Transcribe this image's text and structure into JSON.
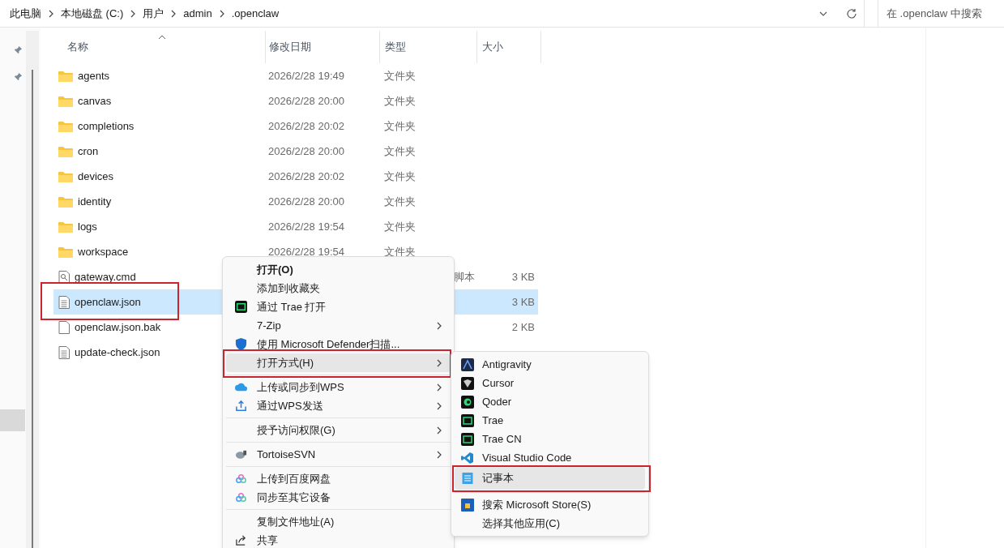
{
  "breadcrumb": [
    "此电脑",
    "本地磁盘 (C:)",
    "用户",
    "admin",
    ".openclaw"
  ],
  "search": {
    "placeholder": "在 .openclaw 中搜索"
  },
  "columns": [
    "名称",
    "修改日期",
    "类型",
    "大小"
  ],
  "rows": [
    {
      "kind": "folder",
      "name": "agents",
      "date": "2026/2/28 19:49",
      "type": "文件夹",
      "selected": false
    },
    {
      "kind": "folder",
      "name": "canvas",
      "date": "2026/2/28 20:00",
      "type": "文件夹",
      "selected": false
    },
    {
      "kind": "folder",
      "name": "completions",
      "date": "2026/2/28 20:02",
      "type": "文件夹",
      "selected": false
    },
    {
      "kind": "folder",
      "name": "cron",
      "date": "2026/2/28 20:00",
      "type": "文件夹",
      "selected": false
    },
    {
      "kind": "folder",
      "name": "devices",
      "date": "2026/2/28 20:02",
      "type": "文件夹",
      "selected": false
    },
    {
      "kind": "folder",
      "name": "identity",
      "date": "2026/2/28 20:00",
      "type": "文件夹",
      "selected": false
    },
    {
      "kind": "folder",
      "name": "logs",
      "date": "2026/2/28 19:54",
      "type": "文件夹",
      "selected": false
    },
    {
      "kind": "folder",
      "name": "workspace",
      "date": "2026/2/28 19:54",
      "type": "文件夹",
      "selected": false
    },
    {
      "kind": "script",
      "name": "gateway.cmd",
      "type": "脚本",
      "size": "3 KB",
      "selected": false
    },
    {
      "kind": "text",
      "name": "openclaw.json",
      "size": "3 KB",
      "selected": true,
      "red_frame": true
    },
    {
      "kind": "blank",
      "name": "openclaw.json.bak",
      "size": "2 KB",
      "selected": false
    },
    {
      "kind": "text",
      "name": "update-check.json",
      "selected": false
    }
  ],
  "context_menu": {
    "groups": [
      [
        {
          "label": "打开(O)",
          "bold": true,
          "submenu": false,
          "selected": false
        },
        {
          "label": "添加到收藏夹",
          "submenu": false,
          "selected": false
        },
        {
          "label": "通过 Trae 打开",
          "submenu": false,
          "selected": false
        },
        {
          "label": "7-Zip",
          "submenu": true,
          "selected": false
        },
        {
          "label": "使用 Microsoft Defender扫描...",
          "submenu": false,
          "selected": false
        },
        {
          "label": "打开方式(H)",
          "submenu": true,
          "selected": true,
          "red_frame": true
        }
      ],
      [
        {
          "label": "上传或同步到WPS",
          "submenu": true,
          "selected": false
        },
        {
          "label": "通过WPS发送",
          "submenu": true,
          "selected": false
        }
      ],
      [
        {
          "label": "授予访问权限(G)",
          "submenu": true,
          "selected": false
        }
      ],
      [
        {
          "label": "TortoiseSVN",
          "submenu": true,
          "selected": false
        }
      ],
      [
        {
          "label": "上传到百度网盘",
          "submenu": false,
          "selected": false
        },
        {
          "label": "同步至其它设备",
          "submenu": false,
          "selected": false
        }
      ],
      [
        {
          "label": "复制文件地址(A)",
          "submenu": false,
          "selected": false
        },
        {
          "label": "共享",
          "submenu": false,
          "selected": false
        }
      ]
    ]
  },
  "open_with_menu": {
    "groups": [
      [
        {
          "label": "Antigravity",
          "selected": false
        },
        {
          "label": "Cursor",
          "selected": false
        },
        {
          "label": "Qoder",
          "selected": false
        },
        {
          "label": "Trae",
          "selected": false
        },
        {
          "label": "Trae CN",
          "selected": false
        },
        {
          "label": "Visual Studio Code",
          "selected": false
        },
        {
          "label": "记事本",
          "selected": true,
          "red_frame": true
        }
      ],
      [
        {
          "label": "搜索 Microsoft Store(S)",
          "selected": false
        },
        {
          "label": "选择其他应用(C)",
          "selected": false
        }
      ]
    ]
  }
}
